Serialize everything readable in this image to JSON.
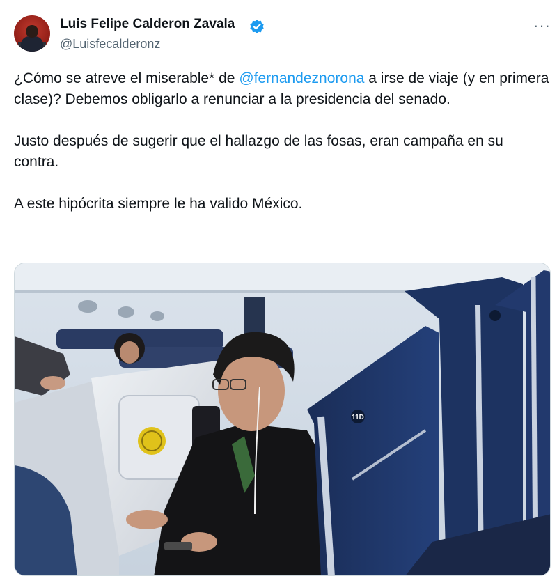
{
  "author": {
    "name": "Luis Felipe Calderon Zavala",
    "handle": "@Luisfecalderonz",
    "verified": true
  },
  "menu": {
    "more_label": "···"
  },
  "tweet": {
    "line1_prefix": "¿Cómo se atreve el miserable* de ",
    "mention": "@fernandeznorona",
    "line1_suffix": " a irse de viaje (y en primera clase)? Debemos obligarlo a renunciar a la presidencia del senado.",
    "paragraph2": "Justo después de sugerir que el hallazgo de las fosas, eran campaña en su contra.",
    "paragraph3": "A este hipócrita siempre le ha valido México."
  },
  "media": {
    "seat_label": "11D",
    "colors": {
      "seat_navy": "#1f3564",
      "cabin_wall": "#e4e9ef",
      "accent": "#1d9bf0"
    }
  }
}
